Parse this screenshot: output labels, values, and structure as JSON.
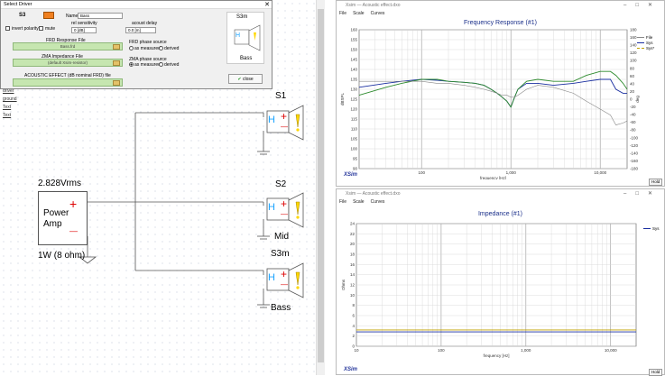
{
  "dialog": {
    "title": "Select Driver",
    "driver_id": "S3",
    "driver_color": "#f08020",
    "name_label": "Name",
    "name_value": "Bass",
    "invert_polarity": "invert polarity",
    "mute": "mute",
    "rel_sensitivity_label": "rel sensitivity",
    "rel_sensitivity_value": "0 [dB]",
    "acoustic_delay_label": "acoust delay",
    "acoustic_delay_value": "0.0 [m]",
    "frd_label": "FRD Response File",
    "frd_value": "Bass.frd",
    "frd_phase_label": "FRD phase source",
    "zma_label": "ZMA Impedance File",
    "zma_value": "(default Xsim-resistor)",
    "zma_phase_label": "ZMA phase source",
    "phase_opt_measured": "as measured",
    "phase_opt_derived": "derived",
    "acoustic_effect": "ACOUSTIC EFFECT (dB nominal FRD) file",
    "preview_name": "S3m",
    "preview_sub": "Bass",
    "close_button": "close",
    "close_x": "✕"
  },
  "toolbox": [
    "driver",
    "ground",
    "Text",
    "Text"
  ],
  "schematic": {
    "source_voltage": "2.828Vrms",
    "amp_label_1": "Power",
    "amp_label_2": "Amp",
    "amp_power": "1W (8 ohm)",
    "plus": "+",
    "minus": "—",
    "drivers": [
      {
        "id": "S1",
        "sub": ""
      },
      {
        "id": "S2",
        "sub": "Mid"
      },
      {
        "id": "S3m",
        "sub": "Bass"
      }
    ],
    "h_glyph": "H"
  },
  "freq_window": {
    "title": "Xsim — Acoustic effect.dxo",
    "menu": [
      "File",
      "Scale",
      "Curves"
    ],
    "chart_title": "Frequency Response (#1)",
    "xlabel": "frequency [Hz]",
    "ylabel_left": "dBSPL",
    "ylabel_right": "deg",
    "hold": "Hold",
    "brand": "XSim",
    "legend": [
      {
        "name": "File",
        "color": "#888888"
      },
      {
        "name": "Sys",
        "color": "#1a2fa0"
      },
      {
        "name": "Sys*",
        "color": "#c0a000"
      }
    ]
  },
  "imp_window": {
    "title": "Xsim — Acoustic effect.dxo",
    "menu": [
      "File",
      "Scale",
      "Curves"
    ],
    "chart_title": "Impedance (#1)",
    "xlabel": "frequency [Hz]",
    "ylabel": "Ohms",
    "hold": "Hold",
    "brand": "XSim",
    "legend": [
      {
        "name": "Sys",
        "color": "#1a2fa0"
      }
    ]
  },
  "chart_data": [
    {
      "type": "line",
      "title": "Frequency Response (#1)",
      "xlabel": "frequency [Hz]",
      "ylabel": "dBSPL",
      "xscale": "log",
      "xlim": [
        20,
        20000
      ],
      "ylim": [
        90,
        160
      ],
      "y2lim": [
        -180,
        180
      ],
      "x_ticks": [
        "100",
        "1,000",
        "10,000"
      ],
      "y_ticks": [
        90,
        95,
        100,
        105,
        110,
        115,
        120,
        125,
        130,
        135,
        140,
        145,
        150,
        155,
        160
      ],
      "y2_ticks": [
        -180,
        -160,
        -140,
        -120,
        -100,
        -80,
        -60,
        -40,
        -20,
        0,
        20,
        40,
        60,
        80,
        100,
        120,
        140,
        160,
        180
      ],
      "grid": true,
      "legend_position": "top-right",
      "series": [
        {
          "name": "Sys",
          "color": "#1a2fa0",
          "x": [
            20,
            40,
            60,
            100,
            150,
            200,
            300,
            400,
            500,
            600,
            700,
            800,
            900,
            1000,
            1100,
            1200,
            1500,
            2000,
            3000,
            5000,
            7000,
            10000,
            13000,
            15000,
            18000,
            20000
          ],
          "y": [
            131,
            133,
            134,
            135,
            134.5,
            134,
            133.5,
            133,
            132,
            130,
            128,
            126,
            124,
            121,
            126,
            130,
            133,
            133,
            132,
            133,
            134,
            135,
            135,
            130,
            128,
            128
          ]
        },
        {
          "name": "",
          "color": "#2e8b2e",
          "x": [
            20,
            40,
            60,
            100,
            150,
            200,
            300,
            400,
            500,
            600,
            700,
            800,
            900,
            1000,
            1100,
            1200,
            1500,
            2000,
            3000,
            5000,
            7000,
            10000,
            13000,
            15000,
            18000,
            20000
          ],
          "y": [
            127,
            131,
            133,
            135,
            135,
            134,
            133.5,
            133,
            132,
            130,
            128,
            126,
            124,
            121,
            126,
            130,
            134,
            135,
            134,
            134,
            137,
            139,
            139,
            137,
            133,
            130
          ]
        },
        {
          "name": "File",
          "color": "#888888",
          "x": [
            20,
            40,
            60,
            100,
            150,
            200,
            300,
            400,
            500,
            600,
            700,
            800,
            900,
            1000,
            1100,
            1200,
            1500,
            2000,
            3000,
            5000,
            7000,
            10000,
            13000,
            15000,
            18000,
            20000
          ],
          "y": [
            134,
            134,
            134,
            134,
            133,
            133,
            132,
            131,
            130,
            129,
            128,
            127,
            127,
            126,
            126,
            127,
            130,
            132,
            131,
            128,
            124,
            120,
            117,
            112,
            113,
            114
          ]
        }
      ]
    },
    {
      "type": "line",
      "title": "Impedance (#1)",
      "xlabel": "frequency [Hz]",
      "ylabel": "Ohms",
      "xscale": "log",
      "xlim": [
        10,
        20000
      ],
      "ylim": [
        0,
        24
      ],
      "x_ticks": [
        "10",
        "100",
        "1,000",
        "10,000"
      ],
      "y_ticks": [
        0,
        2,
        4,
        6,
        8,
        10,
        12,
        14,
        16,
        18,
        20,
        22,
        24
      ],
      "grid": true,
      "legend_position": "top-right",
      "series": [
        {
          "name": "Sys",
          "color": "#1a2fa0",
          "x": [
            10,
            20000
          ],
          "y": [
            2.8,
            2.8
          ]
        },
        {
          "name": "",
          "color": "#c0a000",
          "x": [
            10,
            20000
          ],
          "y": [
            3.2,
            3.2
          ]
        }
      ]
    }
  ]
}
